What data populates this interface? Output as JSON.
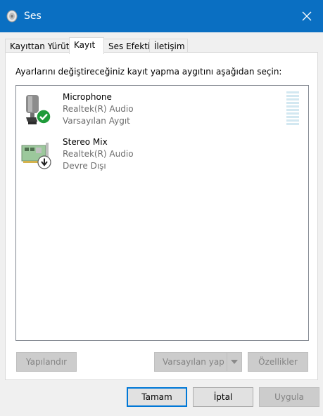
{
  "window": {
    "title": "Ses"
  },
  "tabs": [
    {
      "label": "Kayıttan Yürüt"
    },
    {
      "label": "Kayıt"
    },
    {
      "label": "Ses Efekti"
    },
    {
      "label": "İletişim"
    }
  ],
  "panel": {
    "instruction": "Ayarlarını değiştireceğiniz kayıt yapma aygıtını aşağıdan seçin:",
    "devices": [
      {
        "name": "Microphone",
        "driver": "Realtek(R) Audio",
        "status": "Varsayılan Aygıt",
        "icon": "microphone-icon",
        "badge": "default-check-icon"
      },
      {
        "name": "Stereo Mix",
        "driver": "Realtek(R) Audio",
        "status": "Devre Dışı",
        "icon": "sound-card-icon",
        "badge": "disabled-arrow-icon"
      }
    ],
    "buttons": {
      "configure": "Yapılandır",
      "set_default": "Varsayılan yap",
      "properties": "Özellikler"
    }
  },
  "footer": {
    "ok": "Tamam",
    "cancel": "İptal",
    "apply": "Uygula"
  },
  "colors": {
    "titlebar": "#0a6fc2",
    "level_meter": "#d3e8f1",
    "default_badge": "#1f9b3a"
  }
}
